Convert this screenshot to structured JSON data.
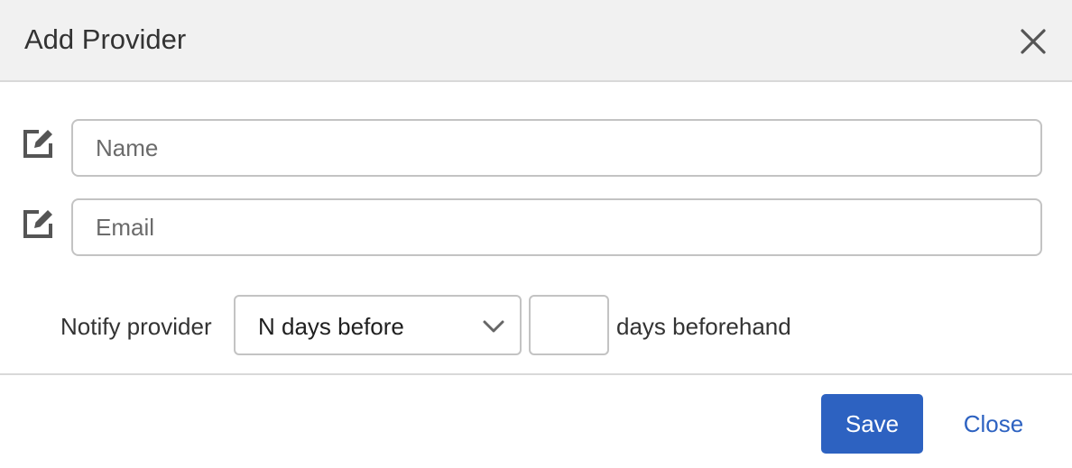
{
  "dialog": {
    "title": "Add Provider",
    "close_icon": "close-x-icon"
  },
  "form": {
    "name": {
      "icon": "edit-icon",
      "placeholder": "Name",
      "value": ""
    },
    "email": {
      "icon": "edit-icon",
      "placeholder": "Email",
      "value": ""
    },
    "notify": {
      "label": "Notify provider",
      "select_value": "N days before",
      "select_icon": "chevron-down-icon",
      "days_value": "",
      "suffix": "days beforehand"
    }
  },
  "footer": {
    "save_label": "Save",
    "close_label": "Close"
  },
  "colors": {
    "header_bg": "#f1f1f1",
    "primary": "#2d62c1",
    "border": "#c3c3c3",
    "icon": "#555555"
  }
}
